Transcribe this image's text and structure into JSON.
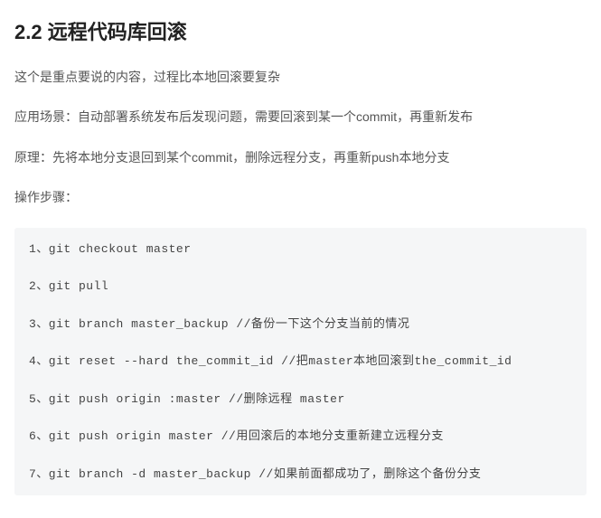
{
  "heading": "2.2 远程代码库回滚",
  "paragraphs": [
    "这个是重点要说的内容，过程比本地回滚要复杂",
    "应用场景：自动部署系统发布后发现问题，需要回滚到某一个commit，再重新发布",
    "原理：先将本地分支退回到某个commit，删除远程分支，再重新push本地分支",
    "操作步骤："
  ],
  "code_lines": [
    "1、git checkout master",
    "2、git pull",
    "3、git branch master_backup //备份一下这个分支当前的情况",
    "4、git reset --hard the_commit_id //把master本地回滚到the_commit_id",
    "5、git push origin :master //删除远程 master",
    "6、git push origin master //用回滚后的本地分支重新建立远程分支",
    "7、git branch -d master_backup //如果前面都成功了，删除这个备份分支"
  ]
}
